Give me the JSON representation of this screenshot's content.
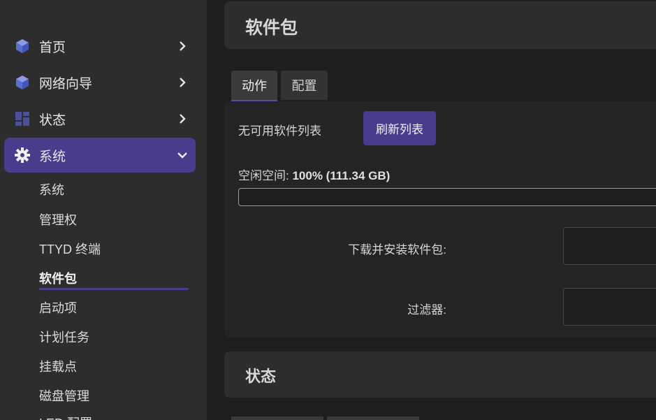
{
  "sidebar": {
    "nav": [
      {
        "label": "首页",
        "icon": "cube-icon",
        "chevron": "chevron-right-icon"
      },
      {
        "label": "网络向导",
        "icon": "cube-icon",
        "chevron": "chevron-right-icon"
      },
      {
        "label": "状态",
        "icon": "dashboard-icon",
        "chevron": "chevron-right-icon"
      },
      {
        "label": "系统",
        "icon": "gear-icon",
        "chevron": "chevron-down-icon"
      }
    ],
    "sub_items": [
      "系统",
      "管理权",
      "TTYD 终端",
      "软件包",
      "启动项",
      "计划任务",
      "挂载点",
      "磁盘管理",
      "LED 配置"
    ],
    "current_sub": "软件包"
  },
  "header": {
    "title": "软件包"
  },
  "tabs": [
    {
      "label": "动作",
      "active": true
    },
    {
      "label": "配置",
      "active": false
    }
  ],
  "actions": {
    "no_list_text": "无可用软件列表",
    "refresh_button": "刷新列表",
    "free_space_label": "空闲空间:",
    "free_space_value": "100% (111.34 GB)",
    "free_space_percent": 100,
    "download_label": "下载并安装软件包:",
    "download_value": "",
    "filter_label": "过滤器:",
    "filter_value": ""
  },
  "status_section": {
    "title": "状态"
  },
  "colors": {
    "accent": "#4a3b8c",
    "sidebar_bg": "#2d2d2d",
    "page_bg": "#1e1e1e",
    "icon_blue": "#6a7fd8"
  }
}
